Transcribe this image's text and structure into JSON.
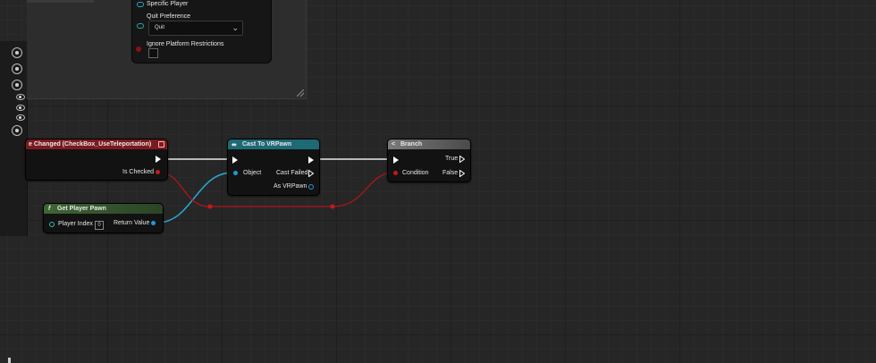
{
  "details_panel": {
    "specific_player_label": "Specific Player",
    "quit_preference_label": "Quit Preference",
    "quit_preference_value": "Quit",
    "ignore_platform_label": "Ignore Platform Restrictions"
  },
  "nodes": {
    "event_changed": {
      "title": "e Changed (CheckBox_UseTeleportation)",
      "out_pin": "Is Checked",
      "color": "#7a1a1e"
    },
    "cast_to": {
      "title": "Cast To VRPawn",
      "object_pin": "Object",
      "cast_failed_pin": "Cast Failed",
      "as_pin": "As VRPawn",
      "color": "#1d6a74"
    },
    "branch": {
      "title": "Branch",
      "condition_pin": "Condition",
      "true_pin": "True",
      "false_pin": "False",
      "color": "#5e5e5e"
    },
    "get_player_pawn": {
      "title": "Get Player Pawn",
      "index_pin": "Player Index",
      "index_value": "0",
      "return_pin": "Return Value",
      "color": "#3b5c32"
    }
  },
  "colors": {
    "bool_red": "#a11a1a",
    "object_blue": "#1e9bd6",
    "exec_white": "#ffffff"
  }
}
